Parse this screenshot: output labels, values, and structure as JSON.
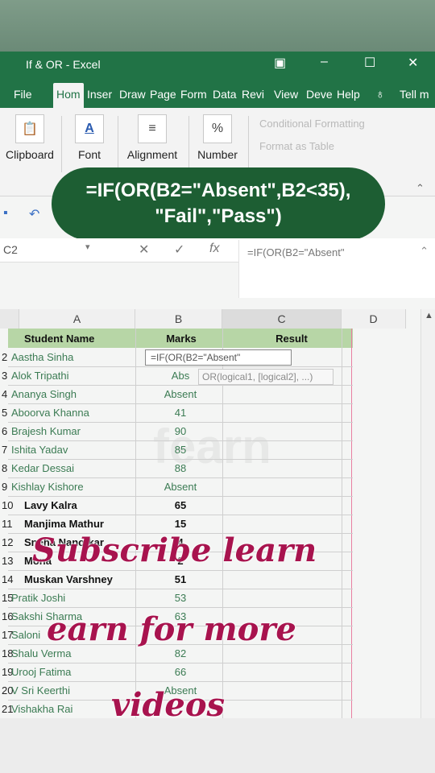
{
  "window": {
    "title": "If & OR  -  Excel",
    "restore_icon": "ribbon-display-icon",
    "minimize": "–",
    "maximize": "☐",
    "close": "✕"
  },
  "tabs": [
    "File",
    "Hom",
    "Inser",
    "Draw",
    "Page",
    "Form",
    "Data",
    "Revi",
    "View",
    "Deve",
    "Help",
    "Tell m"
  ],
  "ribbon": {
    "clipboard": "Clipboard",
    "font": "Font",
    "alignment": "Alignment",
    "number": "Number",
    "conditional_formatting": "Conditional Formatting",
    "format_as_table": "Format as Table"
  },
  "formula_banner": {
    "line1": "=IF(OR(B2=\"Absent\",B2<35),",
    "line2": "\"Fail\",\"Pass\")"
  },
  "formula_bar": {
    "name_box": "C2",
    "cancel": "✕",
    "enter": "✓",
    "fx": "fx",
    "content": "=IF(OR(B2=\"Absent\""
  },
  "columns": [
    "A",
    "B",
    "C",
    "D"
  ],
  "header": {
    "a": "Student Name",
    "b": "Marks",
    "c": "Result"
  },
  "edit_cell": "=IF(OR(B2=\"Absent\"",
  "tooltip": "OR(logical1, [logical2], ...)",
  "rows": [
    {
      "num": "2",
      "name": "Aastha Sinha",
      "marks": ""
    },
    {
      "num": "3",
      "name": "Alok Tripathi",
      "marks": "Abs"
    },
    {
      "num": "4",
      "name": "Ananya Singh",
      "marks": "Absent"
    },
    {
      "num": "5",
      "name": "Aboorva Khanna",
      "marks": "41"
    },
    {
      "num": "6",
      "name": "Brajesh Kumar",
      "marks": "90"
    },
    {
      "num": "7",
      "name": "Ishita Yadav",
      "marks": "85"
    },
    {
      "num": "8",
      "name": "Kedar Dessai",
      "marks": "88"
    },
    {
      "num": "9",
      "name": "Kishlay Kishore",
      "marks": "Absent"
    },
    {
      "num": "10",
      "name": "Lavy Kalra",
      "marks": "65"
    },
    {
      "num": "11",
      "name": "Manjima Mathur",
      "marks": "15"
    },
    {
      "num": "12",
      "name": "Sneha Nanotkar",
      "marks": "4"
    },
    {
      "num": "13",
      "name": "Mona",
      "marks": "2"
    },
    {
      "num": "14",
      "name": "Muskan Varshney",
      "marks": "51"
    },
    {
      "num": "15",
      "name": "Pratik Joshi",
      "marks": "53"
    },
    {
      "num": "16",
      "name": "Sakshi Sharma",
      "marks": "63"
    },
    {
      "num": "17",
      "name": "Saloni",
      "marks": "6"
    },
    {
      "num": "18",
      "name": "Shalu Verma",
      "marks": "82"
    },
    {
      "num": "19",
      "name": "Urooj Fatima",
      "marks": "66"
    },
    {
      "num": "20",
      "name": "V Sri Keerthi",
      "marks": "Absent"
    },
    {
      "num": "21",
      "name": "Vishakha Rai",
      "marks": ""
    }
  ],
  "overlay": {
    "line1": "Subscribe learn",
    "line2": "earn for more",
    "line3": "videos"
  },
  "watermark": "fearn"
}
